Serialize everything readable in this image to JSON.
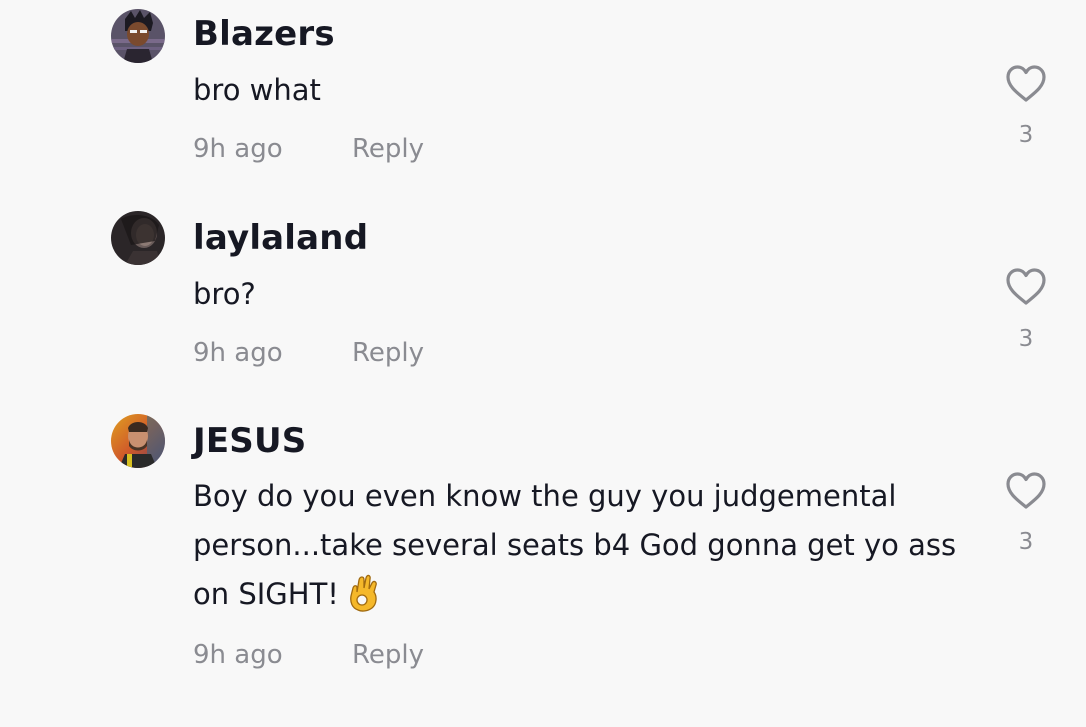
{
  "colors": {
    "background": "#f8f8f8",
    "text_primary": "#161823",
    "text_secondary": "#8a8b91",
    "icon": "#8a8b91"
  },
  "comments": [
    {
      "username": "Blazers",
      "text": "bro what",
      "time": "9h ago",
      "reply_label": "Reply",
      "like_count": "3",
      "avatar_icon": "avatar-cartoon-character",
      "like_icon": "heart-outline-icon"
    },
    {
      "username": "laylaland",
      "text": "bro?",
      "time": "9h ago",
      "reply_label": "Reply",
      "like_count": "3",
      "avatar_icon": "avatar-dark-photo",
      "like_icon": "heart-outline-icon"
    },
    {
      "username": "JESUS",
      "text": "Boy do you even know the guy you judgemental person...take several seats b4 God gonna get yo ass on SIGHT!",
      "text_emoji": "ok-hand-emoji",
      "time": "9h ago",
      "reply_label": "Reply",
      "like_count": "3",
      "avatar_icon": "avatar-bearded-man-photo",
      "like_icon": "heart-outline-icon"
    }
  ]
}
